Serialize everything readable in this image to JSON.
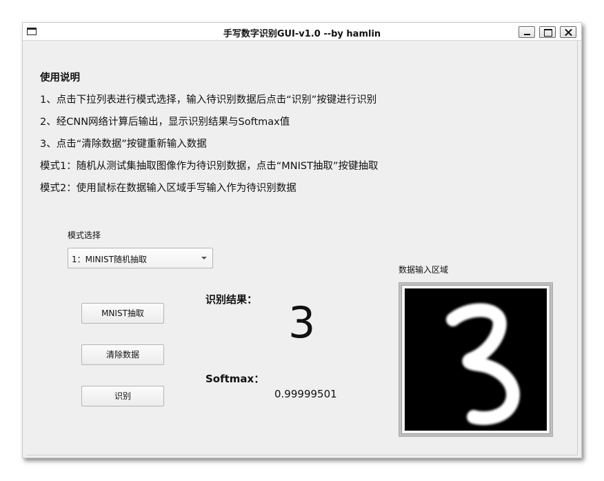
{
  "window": {
    "title": "手写数字识别GUI-v1.0 --by hamlin"
  },
  "instructions": {
    "heading": "使用说明",
    "lines": [
      "1、点击下拉列表进行模式选择，输入待识别数据后点击“识别”按键进行识别",
      "2、经CNN网络计算后输出，显示识别结果与Softmax值",
      "3、点击“清除数据”按键重新输入数据",
      "模式1：随机从测试集抽取图像作为待识别数据，点击“MNIST抽取”按键抽取",
      "模式2：使用鼠标在数据输入区域手写输入作为待识别数据"
    ]
  },
  "mode": {
    "label": "模式选择",
    "selected": "1：MINIST随机抽取"
  },
  "buttons": {
    "mnist": "MNIST抽取",
    "clear": "清除数据",
    "recognize": "识别"
  },
  "result": {
    "label": "识别结果：",
    "digit": "3",
    "softmax_label": "Softmax：",
    "softmax_value": "0.99999501"
  },
  "input_area": {
    "label": "数据输入区域",
    "drawn_digit_icon": "handwritten-3"
  }
}
